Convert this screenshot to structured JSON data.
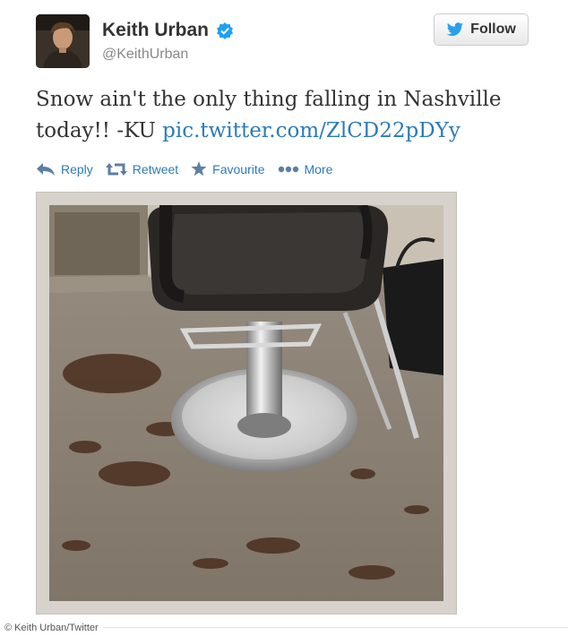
{
  "user": {
    "display_name": "Keith Urban",
    "handle": "@KeithUrban",
    "verified": true
  },
  "follow_button": {
    "label": "Follow",
    "icon": "twitter-bird-icon"
  },
  "tweet": {
    "text": "Snow ain't the only thing falling in Nashville today!! -KU",
    "link": "pic.twitter.com/ZlCD22pDYy"
  },
  "actions": [
    {
      "label": "Reply",
      "icon": "reply-icon"
    },
    {
      "label": "Retweet",
      "icon": "retweet-icon"
    },
    {
      "label": "Favourite",
      "icon": "star-icon"
    },
    {
      "label": "More",
      "icon": "more-dots-icon"
    }
  ],
  "photo": {
    "subject": "salon-chair-with-hair-clippings"
  },
  "credit": "© Keith Urban/Twitter",
  "colors": {
    "link": "#2b7bb9",
    "verified": "#1da1f2",
    "text": "#333333",
    "handle": "#888888"
  }
}
